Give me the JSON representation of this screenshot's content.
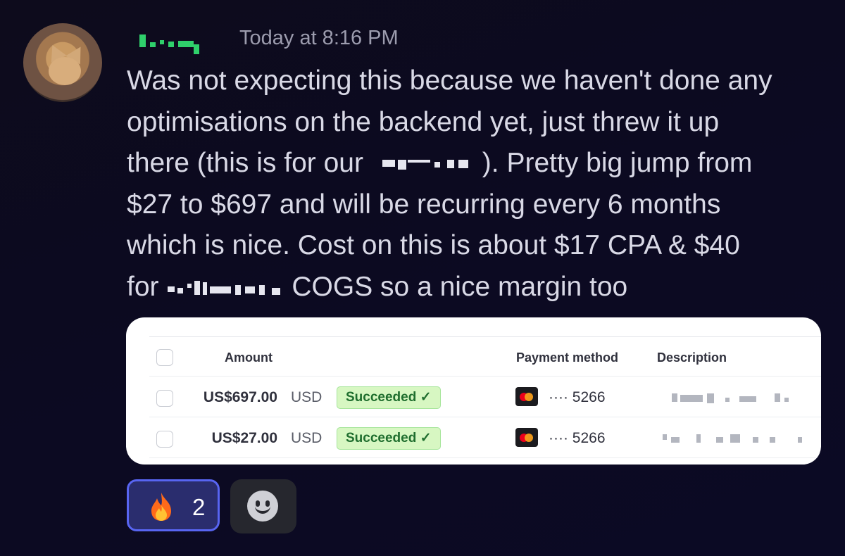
{
  "message": {
    "timestamp": "Today at 8:16 PM",
    "lines": {
      "l1": "Was not expecting this because we haven't done any",
      "l2": "optimisations on the backend yet, just threw it up",
      "l3_before": "there (this is for our ",
      "l3_after": "). Pretty big jump from",
      "l4": "$27 to $697 and will be recurring every 6 months",
      "l5": "which is nice. Cost on this is about $17 CPA & $40",
      "l6_before": "for ",
      "l6_after": "COGS so a nice margin too"
    }
  },
  "payments_table": {
    "headers": {
      "amount": "Amount",
      "payment_method": "Payment method",
      "description": "Description"
    },
    "rows": [
      {
        "amount": "US$697.00",
        "currency": "USD",
        "status": "Succeeded ✓",
        "card_last4": "···· 5266"
      },
      {
        "amount": "US$27.00",
        "currency": "USD",
        "status": "Succeeded ✓",
        "card_last4": "···· 5266"
      }
    ],
    "colors": {
      "status_bg": "#d7f7c2",
      "status_text": "#1f6e2e"
    }
  },
  "reactions": [
    {
      "emoji": "fire-icon",
      "count": "2",
      "active": true
    }
  ],
  "add_reaction_icon": "smiley-add-reaction-icon",
  "colors": {
    "background": "#0c0a20",
    "username": "#2fd06b",
    "reaction_active_bg": "#2a2d6e",
    "reaction_active_border": "#5865f2"
  }
}
